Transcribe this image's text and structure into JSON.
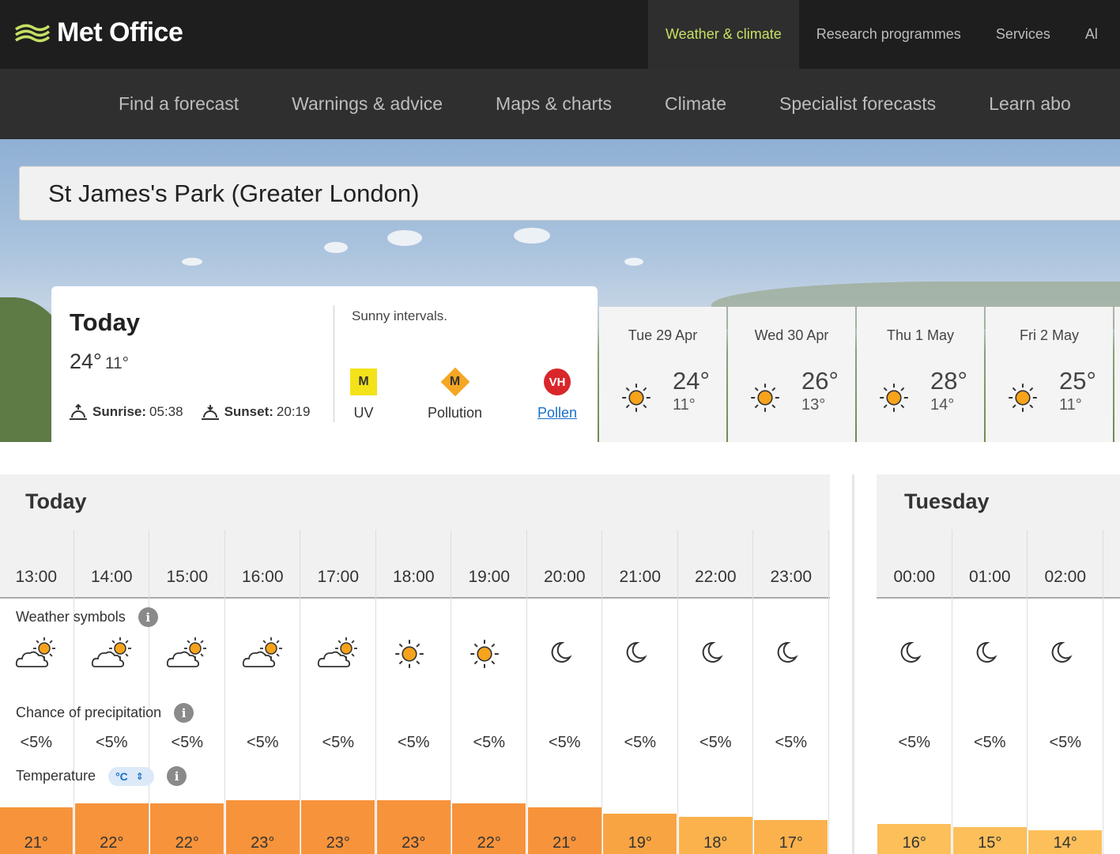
{
  "header": {
    "logo_text": "Met Office",
    "nav": [
      "Weather & climate",
      "Research programmes",
      "Services",
      "Al"
    ]
  },
  "subnav": [
    "Find a forecast",
    "Warnings & advice",
    "Maps & charts",
    "Climate",
    "Specialist forecasts",
    "Learn abo"
  ],
  "search": {
    "value": "St James's Park (Greater London)"
  },
  "today": {
    "title": "Today",
    "high": "24°",
    "low": "11°",
    "sunrise_label": "Sunrise:",
    "sunrise": "05:38",
    "sunset_label": "Sunset:",
    "sunset": "20:19",
    "summary": "Sunny intervals.",
    "uv": {
      "code": "M",
      "label": "UV"
    },
    "pollution": {
      "code": "M",
      "label": "Pollution"
    },
    "pollen": {
      "code": "VH",
      "label": "Pollen"
    }
  },
  "days": [
    {
      "date": "Tue 29 Apr",
      "high": "24°",
      "low": "11°",
      "icon": "sun-icon"
    },
    {
      "date": "Wed 30 Apr",
      "high": "26°",
      "low": "13°",
      "icon": "sun-icon"
    },
    {
      "date": "Thu 1 May",
      "high": "28°",
      "low": "14°",
      "icon": "sun-icon"
    },
    {
      "date": "Fri 2 May",
      "high": "25°",
      "low": "11°",
      "icon": "sun-icon"
    }
  ],
  "hourly_today": {
    "label": "Today",
    "hours": [
      {
        "time": "13:00",
        "symbol": "sunny-intervals",
        "precip": "<5%",
        "temp": "21°",
        "temp_c": 21
      },
      {
        "time": "14:00",
        "symbol": "sunny-intervals",
        "precip": "<5%",
        "temp": "22°",
        "temp_c": 22
      },
      {
        "time": "15:00",
        "symbol": "sunny-intervals",
        "precip": "<5%",
        "temp": "22°",
        "temp_c": 22
      },
      {
        "time": "16:00",
        "symbol": "sunny-intervals",
        "precip": "<5%",
        "temp": "23°",
        "temp_c": 23
      },
      {
        "time": "17:00",
        "symbol": "sunny-intervals",
        "precip": "<5%",
        "temp": "23°",
        "temp_c": 23
      },
      {
        "time": "18:00",
        "symbol": "sunny",
        "precip": "<5%",
        "temp": "23°",
        "temp_c": 23
      },
      {
        "time": "19:00",
        "symbol": "sunny",
        "precip": "<5%",
        "temp": "22°",
        "temp_c": 22
      },
      {
        "time": "20:00",
        "symbol": "clear-night",
        "precip": "<5%",
        "temp": "21°",
        "temp_c": 21
      },
      {
        "time": "21:00",
        "symbol": "clear-night",
        "precip": "<5%",
        "temp": "19°",
        "temp_c": 19
      },
      {
        "time": "22:00",
        "symbol": "clear-night",
        "precip": "<5%",
        "temp": "18°",
        "temp_c": 18
      },
      {
        "time": "23:00",
        "symbol": "clear-night",
        "precip": "<5%",
        "temp": "17°",
        "temp_c": 17
      }
    ]
  },
  "hourly_tuesday": {
    "label": "Tuesday",
    "hours": [
      {
        "time": "00:00",
        "symbol": "clear-night",
        "precip": "<5%",
        "temp": "16°",
        "temp_c": 16
      },
      {
        "time": "01:00",
        "symbol": "clear-night",
        "precip": "<5%",
        "temp": "15°",
        "temp_c": 15
      },
      {
        "time": "02:00",
        "symbol": "clear-night",
        "precip": "<5%",
        "temp": "14°",
        "temp_c": 14
      }
    ]
  },
  "rows": {
    "symbols": "Weather symbols",
    "precip": "Chance of precipitation",
    "temperature": "Temperature",
    "unit": "°C"
  },
  "colors": {
    "accent": "#c5e063",
    "warm": "#f7943c",
    "mild": "#fbb14b"
  }
}
